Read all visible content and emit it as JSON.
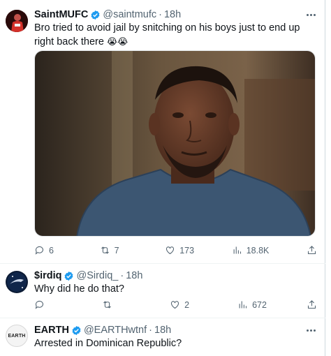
{
  "tweets": [
    {
      "name": "SaintMUFC",
      "handle": "@saintmufc",
      "separator": "·",
      "time": "18h",
      "text": "Bro tried to avoid jail by snitching on his boys just to end up right back there",
      "emoji": "😭😭",
      "stats": {
        "replies": "6",
        "retweets": "7",
        "likes": "173",
        "views": "18.8K"
      }
    },
    {
      "name": "$irdiq",
      "handle": "@Sirdiq_",
      "separator": "·",
      "time": "18h",
      "text": "Why did he do that?",
      "stats": {
        "replies": "",
        "retweets": "",
        "likes": "2",
        "views": "672"
      }
    },
    {
      "name": "EARTH",
      "handle": "@EARTHwtnf",
      "separator": "·",
      "time": "18h",
      "text": "Arrested in Dominican Republic?",
      "avatar_text": "EARTH"
    }
  ],
  "colors": {
    "verified": "#1d9bf0",
    "text": "#0f1419",
    "muted": "#536471"
  },
  "icons": [
    "reply-icon",
    "retweet-icon",
    "like-icon",
    "views-icon",
    "share-icon",
    "verified-badge-icon",
    "more-icon"
  ]
}
